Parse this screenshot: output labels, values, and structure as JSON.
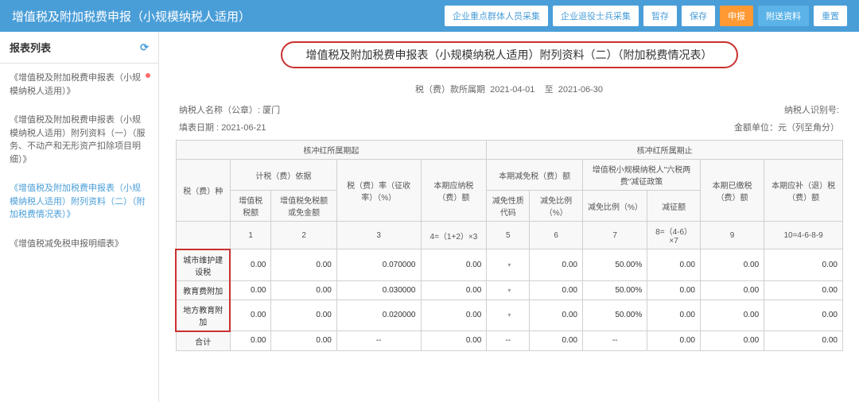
{
  "header": {
    "title": "增值税及附加税费申报（小规模纳税人适用）",
    "buttons": {
      "btn1": "企业重点群体人员采集",
      "btn2": "企业退役士兵采集",
      "btn3": "暂存",
      "btn4": "保存",
      "btn5": "申报",
      "btn6": "附送资料",
      "btn7": "重置"
    }
  },
  "sidebar": {
    "title": "报表列表",
    "items": [
      "《增值税及附加税费申报表（小规模纳税人适用）》",
      "《增值税及附加税费申报表（小规模纳税人适用）附列资料（一）（服务、不动产和无形资产扣除项目明细）》",
      "《增值税及附加税费申报表（小规模纳税人适用）附列资料（二）（附加税费情况表）》",
      "《增值税减免税申报明细表》"
    ]
  },
  "form": {
    "title": "增值税及附加税费申报表（小规模纳税人适用）附列资料（二）（附加税费情况表）",
    "period_label": "税（费）款所属期",
    "period_from": "2021-04-01",
    "period_to_label": "至",
    "period_to": "2021-06-30",
    "taxpayer_name_label": "纳税人名称（公章）:",
    "taxpayer_name": "厦门",
    "taxpayer_id_label": "纳税人识别号:",
    "fill_date_label": "填表日期 :",
    "fill_date": "2021-06-21",
    "unit_label": "金额单位：元（列至角分）"
  },
  "table": {
    "headers": {
      "period_start": "核冲红所属期起",
      "period_end": "核冲红所属期止",
      "tax_type": "税（费）种",
      "calc_base": "计税（费）依据",
      "vat_amount": "增值税税额",
      "vat_exempt": "增值税免税额或免金额",
      "rate": "税（费）率（征收率）（%）",
      "current_payable": "本期应纳税（费）额",
      "current_exempt": "本期减免税（费）额",
      "exempt_code": "减免性质代码",
      "exempt_rate": "减免比例（%）",
      "small_taxpayer": "增值税小规模纳税人\"六税两费\"减征政策",
      "reduce_amount": "减征额",
      "paid": "本期已缴税（费）额",
      "to_pay": "本期应补（退）税（费）额"
    },
    "col_nums": {
      "c1": "1",
      "c2": "2",
      "c3": "3",
      "c4": "4=（1+2）×3",
      "c5": "5",
      "c6": "6",
      "c7": "7",
      "c8": "8=（4-6）×7",
      "c9": "9",
      "c10": "10=4-6-8-9"
    },
    "rows": [
      {
        "name": "城市维护建设税",
        "c1": "0.00",
        "c2": "0.00",
        "c3": "0.070000",
        "c4": "0.00",
        "c5": "",
        "c6": "0.00",
        "c7": "50.00%",
        "c8": "0.00",
        "c9": "0.00",
        "c10": "0.00"
      },
      {
        "name": "教育费附加",
        "c1": "0.00",
        "c2": "0.00",
        "c3": "0.030000",
        "c4": "0.00",
        "c5": "",
        "c6": "0.00",
        "c7": "50.00%",
        "c8": "0.00",
        "c9": "0.00",
        "c10": "0.00"
      },
      {
        "name": "地方教育附加",
        "c1": "0.00",
        "c2": "0.00",
        "c3": "0.020000",
        "c4": "0.00",
        "c5": "",
        "c6": "0.00",
        "c7": "50.00%",
        "c8": "0.00",
        "c9": "0.00",
        "c10": "0.00"
      }
    ],
    "total": {
      "name": "合计",
      "c1": "0.00",
      "c2": "0.00",
      "c3": "--",
      "c4": "0.00",
      "c5": "--",
      "c6": "0.00",
      "c7": "--",
      "c8": "0.00",
      "c9": "0.00",
      "c10": "0.00"
    }
  }
}
